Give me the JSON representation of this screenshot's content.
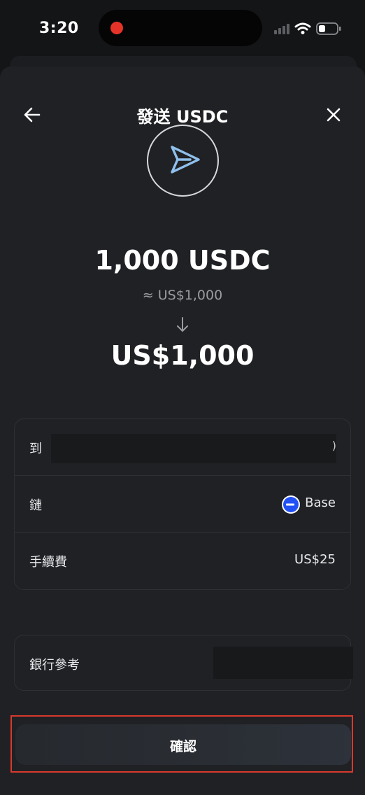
{
  "status_bar": {
    "time": "3:20"
  },
  "header": {
    "title": "發送 USDC"
  },
  "summary": {
    "amount": "1,000 USDC",
    "approx_value": "≈ US$1,000",
    "fiat_amount": "US$1,000"
  },
  "details": {
    "to": {
      "label": "到",
      "value_tail": ")"
    },
    "chain": {
      "label": "鏈",
      "value": "Base"
    },
    "fee": {
      "label": "手續費",
      "value": "US$25"
    }
  },
  "bank_reference": {
    "label": "銀行參考"
  },
  "actions": {
    "confirm_label": "確認"
  },
  "colors": {
    "sheet_background": "#202124",
    "base_blue": "#2151f5",
    "highlight_outline": "#d8392e"
  },
  "icons": {
    "back": "arrow-left-icon",
    "close": "close-icon",
    "send": "send-icon",
    "down": "arrow-down-icon",
    "chain": "base-logo-icon"
  }
}
